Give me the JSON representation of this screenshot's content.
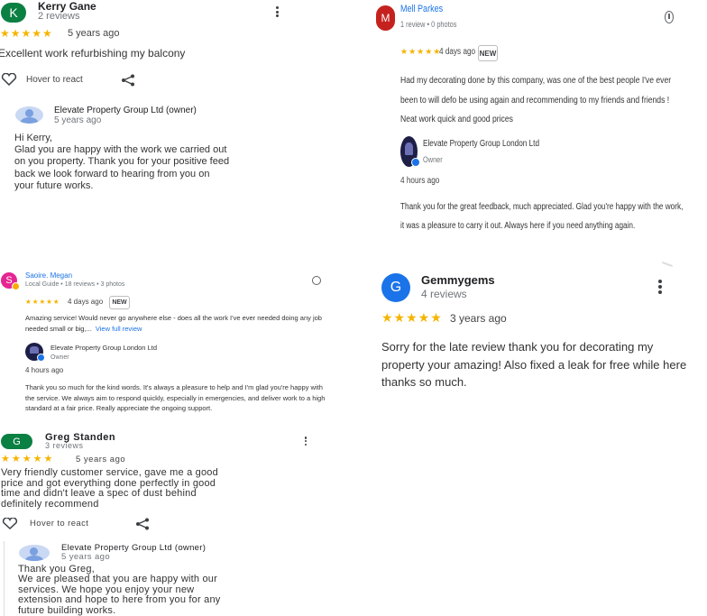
{
  "colors": {
    "star": "#f5b400",
    "kerry_avatar": "#0b8043",
    "gemmy_avatar": "#1a73e8",
    "mell_avatar": "#c5221f",
    "saoire_avatar": "#e52592",
    "greg_avatar": "#0b8043",
    "link": "#1a73e8"
  },
  "kerry": {
    "initial": "K",
    "name": "Kerry Gane",
    "meta": "2 reviews",
    "stars": "★★★★★",
    "time": "5 years ago",
    "text": "Excellent work refurbishing my balcony",
    "react": "Hover to react",
    "owner": {
      "name": "Elevate Property Group Ltd (owner)",
      "time": "5 years ago",
      "reply": "Hi Kerry,\nGlad you are happy with the work we carried out\non you property. Thank you for your positive feed\nback we look forward to hearing from you on\nyour future works."
    }
  },
  "mell": {
    "initial": "M",
    "name": "Mell Parkes",
    "meta": "1 review • 0 photos",
    "stars": "★★★★★",
    "time": "4 days ago",
    "badge": "NEW",
    "text": "Had my decorating done by this company, was one of the best people I've ever been to will defo be using again and recommending to my friends and friends ! Neat work quick and good prices",
    "owner": {
      "name": "Elevate Property Group London Ltd",
      "role": "Owner",
      "time": "4 hours ago",
      "reply": "Thank you for the great feedback, much appreciated. Glad you're happy with the work, it was a pleasure to carry it out. Always here if you need anything again."
    }
  },
  "saoire": {
    "initial": "S",
    "name": "Saoire. Megan",
    "meta": "Local Guide • 18 reviews • 3 photos",
    "stars": "★★★★★",
    "time": "4 days ago",
    "badge": "NEW",
    "text": "Amazing service! Would never go anywhere else - does all the work I've ever needed doing any job needed small or big,...",
    "more": "View full review",
    "owner": {
      "name": "Elevate Property Group London Ltd",
      "role": "Owner",
      "time": "4 hours ago",
      "reply": "Thank you so much for the kind words. It's always a pleasure to help and I'm glad you're happy with the service. We always aim to respond quickly, especially in emergencies, and deliver work to a high standard at a fair price. Really appreciate the ongoing support."
    }
  },
  "gemmy": {
    "initial": "G",
    "name": "Gemmygems",
    "meta": "4 reviews",
    "stars": "★★★★★",
    "time": "3 years ago",
    "text": "Sorry for the late review thank you for decorating my property your amazing! Also fixed a leak for free while here thanks so much."
  },
  "greg": {
    "initial": "G",
    "name": "Greg Standen",
    "meta": "3 reviews",
    "stars": "★★★★★",
    "time": "5 years ago",
    "text": "Very friendly customer service, gave me a good\nprice and got everything done perfectly in good\ntime and didn't leave a spec of dust behind\ndefinitely recommend",
    "react": "Hover to react",
    "owner": {
      "name": "Elevate Property Group Ltd (owner)",
      "time": "5 years ago",
      "reply": "Thank you Greg,\nWe are pleased that you are happy with our\nservices. We hope you enjoy your new\nextension and hope to here from you for any\nfuture building works."
    }
  }
}
